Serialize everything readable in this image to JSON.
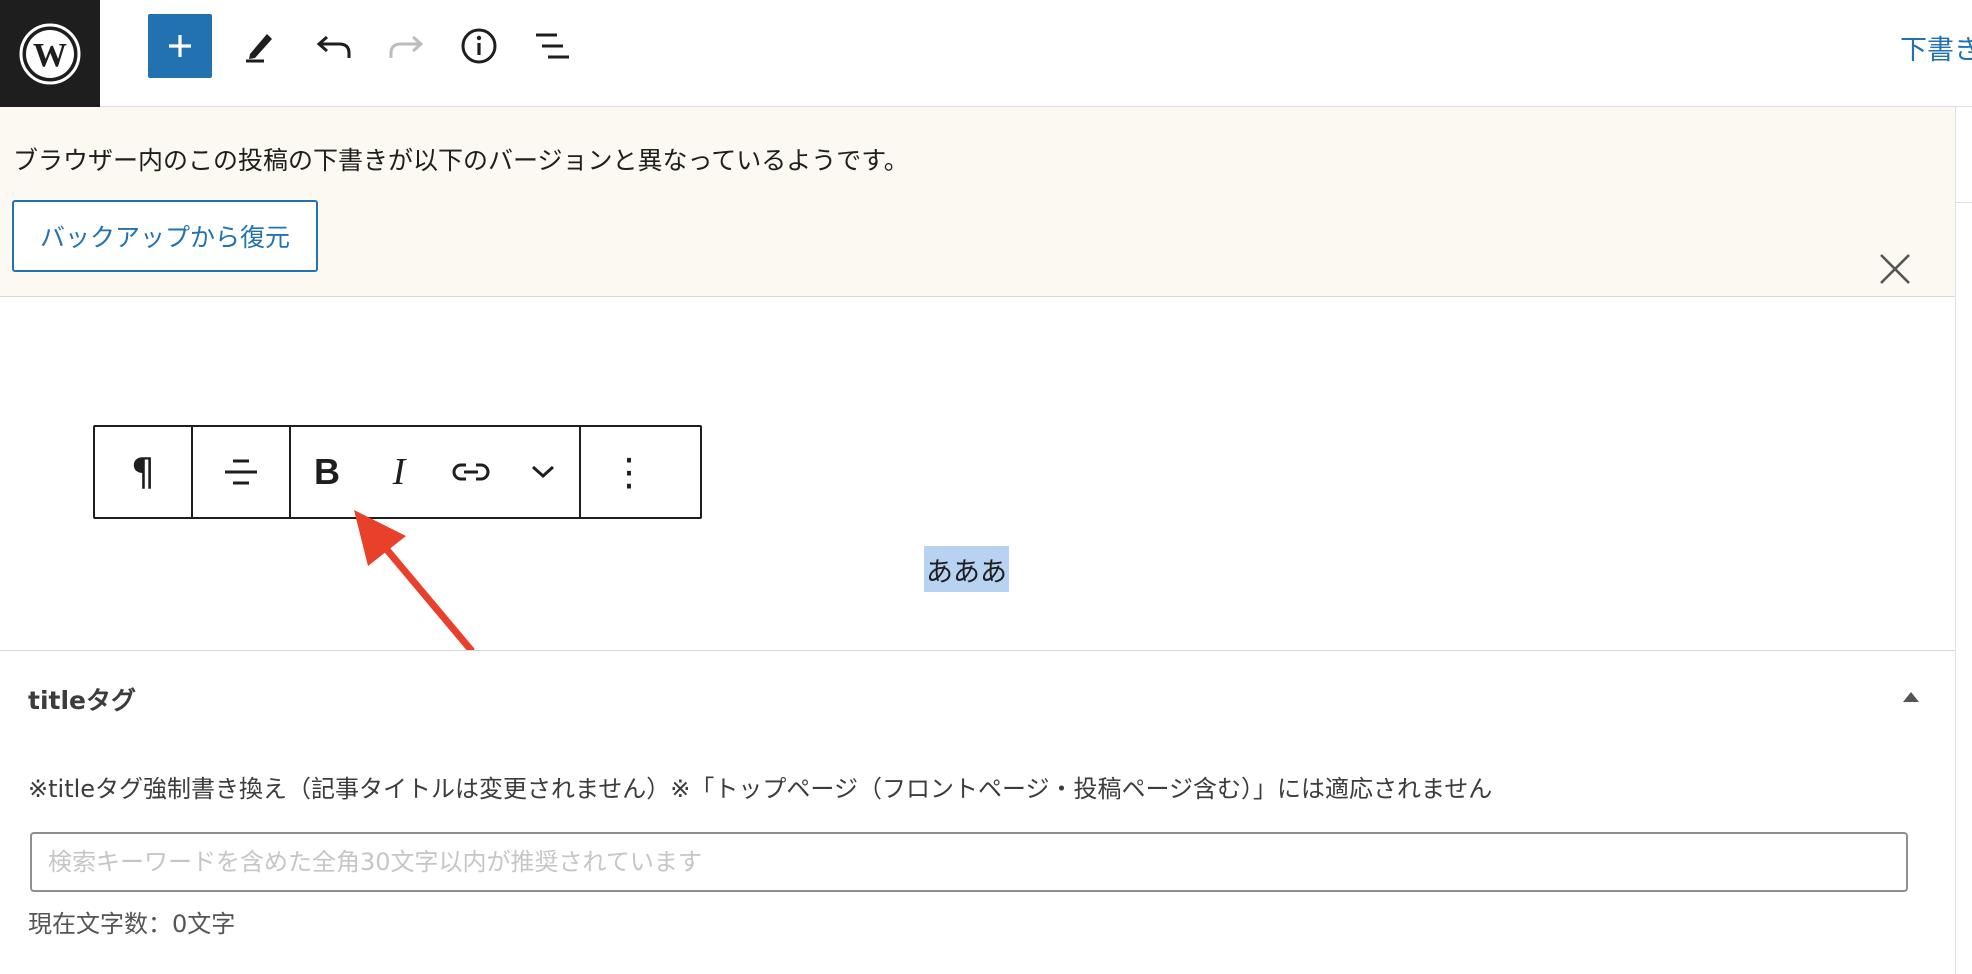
{
  "topbar": {
    "logo_icon": "wordpress-logo",
    "add_icon": "plus-icon",
    "tools_icon": "pencil-icon",
    "undo_icon": "undo-icon",
    "redo_icon": "redo-icon",
    "details_icon": "info-icon",
    "list_view_icon": "list-view-icon",
    "save_draft_label": "下書き"
  },
  "notice": {
    "message": "ブラウザー内のこの投稿の下書きが以下のバージョンと異なっているようです。",
    "restore_button_label": "バックアップから復元",
    "close_icon": "close-icon"
  },
  "block_toolbar": {
    "block_type_label": "¶",
    "align_icon": "align-center-icon",
    "bold_label": "B",
    "italic_label": "I",
    "link_icon": "link-icon",
    "more_icon": "chevron-down-icon",
    "options_label": "⋮"
  },
  "editor": {
    "selected_text": "あああ"
  },
  "meta_box": {
    "title": "titleタグ",
    "description": "※titleタグ強制書き換え（記事タイトルは変更されません）※「トップページ（フロントページ・投稿ページ含む）」には適応されません",
    "input_value": "",
    "input_placeholder": "検索キーワードを含めた全角30文字以内が推奨されています",
    "char_count_label": "現在文字数：0文字"
  },
  "colors": {
    "accent": "#2271b1",
    "notice_bg": "#fcf8f2",
    "selection": "#b8d3f2",
    "annotation_arrow": "#e8402a"
  }
}
